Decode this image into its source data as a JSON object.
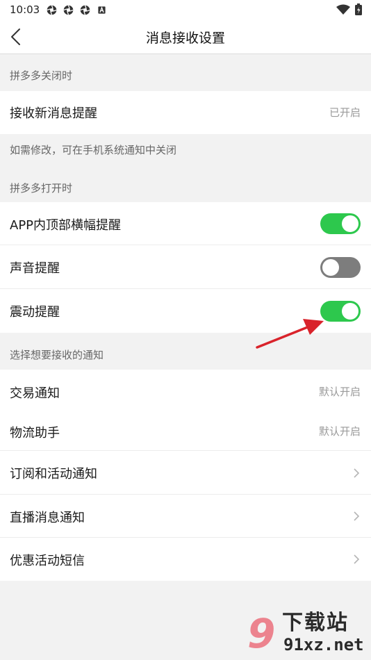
{
  "status_bar": {
    "time": "10:03",
    "notification_icons": [
      "aperture-icon",
      "aperture-icon",
      "aperture-icon",
      "a-badge-icon"
    ],
    "right_icons": [
      "wifi-icon",
      "battery-charging-icon"
    ]
  },
  "header": {
    "title": "消息接收设置",
    "back_icon": "chevron-left-icon"
  },
  "sections": {
    "closed": {
      "label": "拼多多关闭时",
      "row": {
        "label": "接收新消息提醒",
        "value": "已开启"
      },
      "hint": "如需修改，可在手机系统通知中关闭"
    },
    "open": {
      "label": "拼多多打开时",
      "toggles": [
        {
          "label": "APP内顶部横幅提醒",
          "on": true
        },
        {
          "label": "声音提醒",
          "on": false
        },
        {
          "label": "震动提醒",
          "on": true
        }
      ]
    },
    "choose": {
      "label": "选择想要接收的通知",
      "items": [
        {
          "label": "交易通知",
          "value": "默认开启"
        },
        {
          "label": "物流助手",
          "value": "默认开启"
        },
        {
          "label": "订阅和活动通知",
          "chevron": true
        },
        {
          "label": "直播消息通知",
          "chevron": true
        },
        {
          "label": "优惠活动短信",
          "chevron": true
        }
      ]
    }
  },
  "colors": {
    "toggle_on": "#2dc84d",
    "toggle_off": "#7d7d7d",
    "annotation_arrow": "#d9232b"
  },
  "watermark": {
    "number": "9",
    "title": "下载站",
    "url": "91xz.net"
  }
}
